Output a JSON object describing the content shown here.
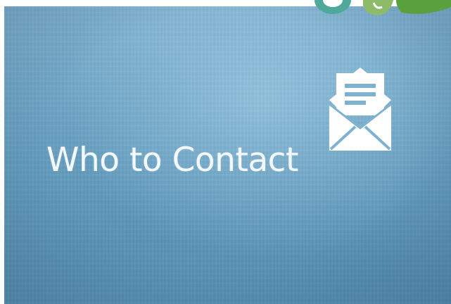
{
  "slide": {
    "title": "Who to Contact",
    "background_color": "#6fa6c6",
    "text_color": "#f2f8fc"
  },
  "icons": {
    "envelope": "open-envelope-icon",
    "logo": "logo-fragment"
  },
  "colors": {
    "icon_color": "#ffffff",
    "logo_teal": "#4fa99a",
    "logo_green": "#6aa84f"
  }
}
